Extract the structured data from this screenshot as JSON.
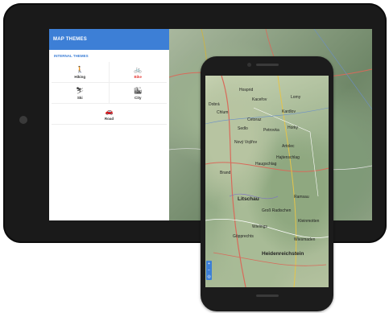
{
  "panel": {
    "title": "MAP THEMES",
    "section": "INTERNAL THEMES",
    "themes": [
      {
        "label": "Hiking",
        "icon": "hiking-icon",
        "glyph": "🚶",
        "selected": false
      },
      {
        "label": "Bike",
        "icon": "bike-icon",
        "glyph": "🚲",
        "selected": true
      },
      {
        "label": "Ski",
        "icon": "ski-icon",
        "glyph": "⛷",
        "selected": false
      },
      {
        "label": "City",
        "icon": "city-icon",
        "glyph": "🏙",
        "selected": false
      },
      {
        "label": "Road",
        "icon": "car-icon",
        "glyph": "🚗",
        "selected": false
      }
    ]
  },
  "phone_map": {
    "places": [
      {
        "name": "Hosprid",
        "big": false
      },
      {
        "name": "Kaceřov",
        "big": false
      },
      {
        "name": "Lomy",
        "big": false
      },
      {
        "name": "Dobrá",
        "big": false
      },
      {
        "name": "Kardlov",
        "big": false
      },
      {
        "name": "Chlum",
        "big": false
      },
      {
        "name": "Cetoraz",
        "big": false
      },
      {
        "name": "Sedlo",
        "big": false
      },
      {
        "name": "Petrovka",
        "big": false
      },
      {
        "name": "Horky",
        "big": false
      },
      {
        "name": "Nový Vojířov",
        "big": false
      },
      {
        "name": "Artolec",
        "big": false
      },
      {
        "name": "Hajtenschlag",
        "big": false
      },
      {
        "name": "Haugschlag",
        "big": false
      },
      {
        "name": "Brand",
        "big": false
      },
      {
        "name": "Litschau",
        "big": true
      },
      {
        "name": "Ramsau",
        "big": false
      },
      {
        "name": "Groß Radischen",
        "big": false
      },
      {
        "name": "Kleinmotten",
        "big": false
      },
      {
        "name": "Wielings",
        "big": false
      },
      {
        "name": "Göpprechts",
        "big": false
      },
      {
        "name": "Wiesmaden",
        "big": false
      },
      {
        "name": "Heidenreichstein",
        "big": true
      }
    ]
  },
  "colors": {
    "accent": "#3d7fd6",
    "selected": "#e53935"
  }
}
